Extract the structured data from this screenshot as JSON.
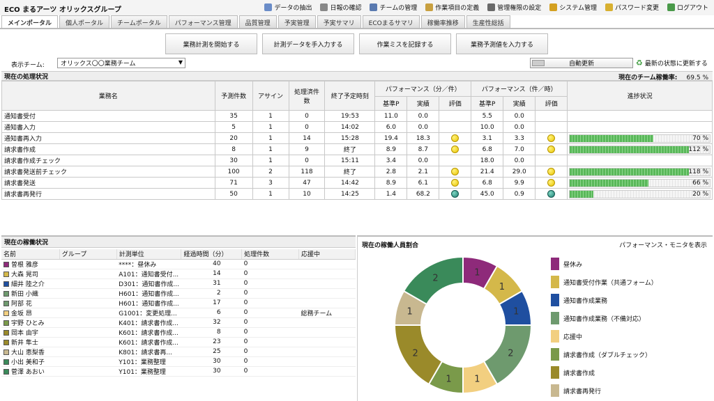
{
  "app_title": "ECO まるアーツ オリックスグループ",
  "top_menu": [
    {
      "label": "データの抽出",
      "icon": "export-icon",
      "color": "#6a8cc8"
    },
    {
      "label": "日報の確認",
      "icon": "calendar-icon",
      "color": "#888888"
    },
    {
      "label": "チームの管理",
      "icon": "team-icon",
      "color": "#5a7ab0"
    },
    {
      "label": "作業項目の定義",
      "icon": "pencil-icon",
      "color": "#c8a040"
    },
    {
      "label": "管理権限の設定",
      "icon": "user-key-icon",
      "color": "#6a6a6a"
    },
    {
      "label": "システム管理",
      "icon": "gear-icon",
      "color": "#d4a020"
    },
    {
      "label": "パスワード変更",
      "icon": "key-icon",
      "color": "#d8b030"
    },
    {
      "label": "ログアウト",
      "icon": "logout-icon",
      "color": "#4a9a4a"
    }
  ],
  "tabs": [
    "メインポータル",
    "個人ポータル",
    "チームポータル",
    "パフォーマンス管理",
    "品質管理",
    "予実管理",
    "予実サマリ",
    "ECOまるサマリ",
    "稼働率推移",
    "生産性総括"
  ],
  "actions": [
    "業務計測を開始する",
    "計測データを手入力する",
    "作業ミスを記録する",
    "業務予測値を入力する"
  ],
  "team": {
    "label": "表示チーム:",
    "selected": "オリックス〇〇業務チーム"
  },
  "auto_update": "自動更新",
  "refresh": "最新の状態に更新する",
  "processing": {
    "title": "現在の処理状況",
    "rate_label": "現在のチーム稼働率:",
    "rate_value": "69.5 %",
    "headers": {
      "name": "業務名",
      "forecast": "予測件数",
      "assign": "アサイン",
      "done": "処理済件数",
      "end": "終了予定時刻",
      "perf1": "パフォーマンス（分／件）",
      "perf2": "パフォーマンス（件／時）",
      "progress": "進捗状況",
      "base": "基準P",
      "actual": "実績",
      "eval": "評価"
    },
    "rows": [
      {
        "name": "通知書受付",
        "forecast": "35",
        "assign": "1",
        "done": "0",
        "end": "19:53",
        "b1": "11.0",
        "a1": "0.0",
        "e1": "",
        "b2": "5.5",
        "a2": "0.0",
        "e2": "",
        "pct": "",
        "pv": 0
      },
      {
        "name": "通知書入力",
        "forecast": "5",
        "assign": "1",
        "done": "0",
        "end": "14:02",
        "b1": "6.0",
        "a1": "0.0",
        "e1": "",
        "b2": "10.0",
        "a2": "0.0",
        "e2": "",
        "pct": "",
        "pv": 0
      },
      {
        "name": "通知書再入力",
        "forecast": "20",
        "assign": "1",
        "done": "14",
        "end": "15:28",
        "b1": "19.4",
        "a1": "18.3",
        "e1": "smile",
        "b2": "3.1",
        "a2": "3.3",
        "e2": "smile",
        "pct": "70 %",
        "pv": 70
      },
      {
        "name": "請求書作成",
        "forecast": "8",
        "assign": "1",
        "done": "9",
        "end": "終了",
        "b1": "8.9",
        "a1": "8.7",
        "e1": "smile",
        "b2": "6.8",
        "a2": "7.0",
        "e2": "smile",
        "pct": "112 %",
        "pv": 112
      },
      {
        "name": "請求書作成チェック",
        "forecast": "30",
        "assign": "1",
        "done": "0",
        "end": "15:11",
        "b1": "3.4",
        "a1": "0.0",
        "e1": "",
        "b2": "18.0",
        "a2": "0.0",
        "e2": "",
        "pct": "",
        "pv": 0
      },
      {
        "name": "請求書発送前チェック",
        "forecast": "100",
        "assign": "2",
        "done": "118",
        "end": "終了",
        "b1": "2.8",
        "a1": "2.1",
        "e1": "smile",
        "b2": "21.4",
        "a2": "29.0",
        "e2": "smile",
        "pct": "118 %",
        "pv": 118
      },
      {
        "name": "請求書発送",
        "forecast": "71",
        "assign": "3",
        "done": "47",
        "end": "14:42",
        "b1": "8.9",
        "a1": "6.1",
        "e1": "smile",
        "b2": "6.8",
        "a2": "9.9",
        "e2": "smile",
        "pct": "66 %",
        "pv": 66
      },
      {
        "name": "請求書再発行",
        "forecast": "50",
        "assign": "1",
        "done": "10",
        "end": "14:25",
        "b1": "1.4",
        "a1": "68.2",
        "e1": "sad",
        "b2": "45.0",
        "a2": "0.9",
        "e2": "sad",
        "pct": "20 %",
        "pv": 20
      }
    ]
  },
  "operators": {
    "title": "現在の稼働状況",
    "headers": [
      "名前",
      "グループ",
      "計測単位",
      "経過時間（分）",
      "処理件数",
      "応援中"
    ],
    "rows": [
      {
        "name": "曽根 雅彦",
        "group": "",
        "unit": "****：昼休み",
        "elapsed": "40",
        "count": "0",
        "support": "",
        "color": "#8e2a7a"
      },
      {
        "name": "大森 晃司",
        "group": "",
        "unit": "A101：通知書受付...",
        "elapsed": "14",
        "count": "0",
        "support": "",
        "color": "#d4b84a"
      },
      {
        "name": "細井 陸之介",
        "group": "",
        "unit": "D301：通知書作成...",
        "elapsed": "31",
        "count": "0",
        "support": "",
        "color": "#1f4fa0"
      },
      {
        "name": "新田 小織",
        "group": "",
        "unit": "H601：通知書作成...",
        "elapsed": "2",
        "count": "0",
        "support": "",
        "color": "#6e9a6e"
      },
      {
        "name": "阿部 花",
        "group": "",
        "unit": "H601：通知書作成...",
        "elapsed": "17",
        "count": "0",
        "support": "",
        "color": "#6e9a6e"
      },
      {
        "name": "金坂 昂",
        "group": "",
        "unit": "G1001：変更処理...",
        "elapsed": "6",
        "count": "0",
        "support": "総務チーム",
        "color": "#f2cf80"
      },
      {
        "name": "宇野 ひとみ",
        "group": "",
        "unit": "K401：請求書作成...",
        "elapsed": "32",
        "count": "0",
        "support": "",
        "color": "#7a9a4a"
      },
      {
        "name": "岡本 由宇",
        "group": "",
        "unit": "K601：請求書作成...",
        "elapsed": "8",
        "count": "0",
        "support": "",
        "color": "#9a8a2a"
      },
      {
        "name": "新井 隼士",
        "group": "",
        "unit": "K601：請求書作成...",
        "elapsed": "23",
        "count": "0",
        "support": "",
        "color": "#9a8a2a"
      },
      {
        "name": "大山 恵梨香",
        "group": "",
        "unit": "K801：請求書再...",
        "elapsed": "25",
        "count": "0",
        "support": "",
        "color": "#c8b890"
      },
      {
        "name": "小出 美和子",
        "group": "",
        "unit": "Y101：業務整理",
        "elapsed": "30",
        "count": "0",
        "support": "",
        "color": "#3a8a5a"
      },
      {
        "name": "菅澤 あおい",
        "group": "",
        "unit": "Y101：業務整理",
        "elapsed": "30",
        "count": "0",
        "support": "",
        "color": "#3a8a5a"
      }
    ]
  },
  "ratio": {
    "title": "現在の稼働人員割合",
    "link": "パフォーマンス・モニタを表示"
  },
  "chart_data": {
    "type": "pie",
    "title": "",
    "slices": [
      {
        "label": "",
        "value": 1,
        "color": "#8e2a7a"
      },
      {
        "label": "",
        "value": 1,
        "color": "#d4b84a"
      },
      {
        "label": "",
        "value": 1,
        "color": "#1f4fa0"
      },
      {
        "label": "",
        "value": 2,
        "color": "#6e9a6e"
      },
      {
        "label": "",
        "value": 1,
        "color": "#f2cf80"
      },
      {
        "label": "",
        "value": 1,
        "color": "#7a9a4a"
      },
      {
        "label": "",
        "value": 2,
        "color": "#9a8a2a"
      },
      {
        "label": "",
        "value": 1,
        "color": "#c8b890"
      },
      {
        "label": "",
        "value": 2,
        "color": "#3a8a5a"
      }
    ],
    "legend": [
      {
        "label": "昼休み",
        "color": "#8e2a7a"
      },
      {
        "label": "通知書受付作業（共通フォーム）",
        "color": "#d4b84a"
      },
      {
        "label": "通知書作成業務",
        "color": "#1f4fa0"
      },
      {
        "label": "通知書作成業務（不備対応）",
        "color": "#6e9a6e"
      },
      {
        "label": "応援中",
        "color": "#f2cf80"
      },
      {
        "label": "請求書作成（ダブルチェック）",
        "color": "#7a9a4a"
      },
      {
        "label": "請求書作成",
        "color": "#9a8a2a"
      },
      {
        "label": "請求書再発行",
        "color": "#c8b890"
      }
    ]
  }
}
